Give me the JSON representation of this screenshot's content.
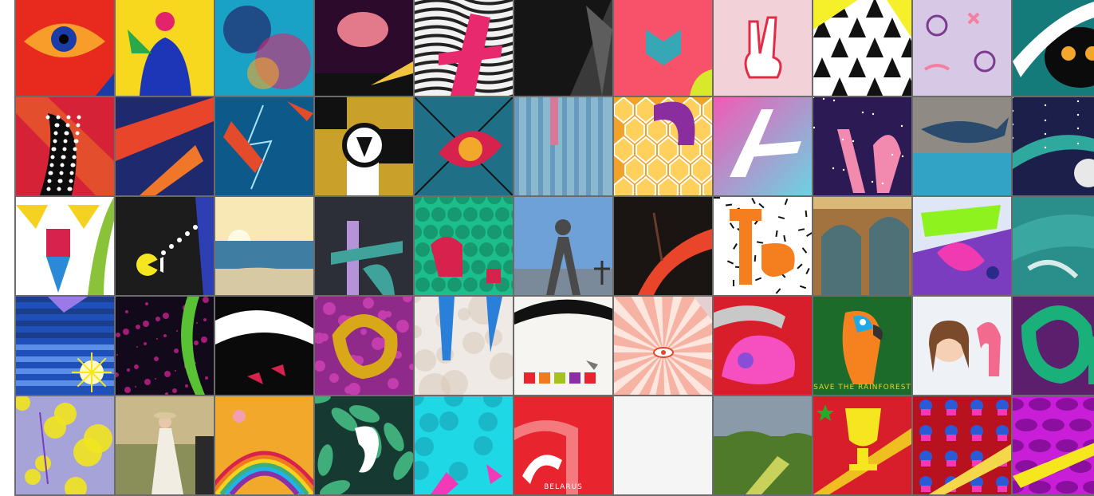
{
  "gallery": {
    "columns": 11,
    "tiles": [
      {
        "id": "r1c1",
        "bg": "#e82a1e",
        "fg": "#ffcf2e",
        "accent": "#1b3ca6",
        "motif": "eye",
        "caption": ""
      },
      {
        "id": "r1c2",
        "bg": "#f7d81f",
        "fg": "#1d36b8",
        "accent": "#e3246c",
        "motif": "figure",
        "caption": ""
      },
      {
        "id": "r1c3",
        "bg": "#1aa2c6",
        "fg": "#d8266f",
        "accent": "#23135e",
        "motif": "ink",
        "caption": ""
      },
      {
        "id": "r1c4",
        "bg": "#2b0a2c",
        "fg": "#e37a8c",
        "accent": "#f2c33c",
        "motif": "brain",
        "caption": ""
      },
      {
        "id": "r1c5",
        "bg": "#f2f2f2",
        "fg": "#e8296d",
        "accent": "#222222",
        "motif": "waves",
        "caption": ""
      },
      {
        "id": "r1c6",
        "bg": "#3a3a3a",
        "fg": "#151515",
        "accent": "#5d5d5d",
        "motif": "dark",
        "caption": ""
      },
      {
        "id": "r1c7",
        "bg": "#f7526a",
        "fg": "#35a7b5",
        "accent": "#ff8a5c",
        "motif": "chevron",
        "caption": ""
      },
      {
        "id": "r1c8",
        "bg": "#f2d1d8",
        "fg": "#e32b46",
        "accent": "#ffffff",
        "motif": "hand",
        "caption": ""
      },
      {
        "id": "r1c9",
        "bg": "#ffffff",
        "fg": "#111111",
        "accent": "#f5f02a",
        "motif": "triangles",
        "caption": ""
      },
      {
        "id": "r1c10",
        "bg": "#d7c9e6",
        "fg": "#7c3b8f",
        "accent": "#f57f9f",
        "motif": "pattern",
        "caption": ""
      },
      {
        "id": "r1c11",
        "bg": "#157b7a",
        "fg": "#0b0b0b",
        "accent": "#f2a72a",
        "motif": "cat",
        "caption": ""
      },
      {
        "id": "r2c1",
        "bg": "#d62236",
        "fg": "#0c0c0c",
        "accent": "#ffffff",
        "motif": "dots",
        "caption": ""
      },
      {
        "id": "r2c2",
        "bg": "#1f2a6e",
        "fg": "#e8452a",
        "accent": "#f0762a",
        "motif": "diagonal",
        "caption": ""
      },
      {
        "id": "r2c3",
        "bg": "#0d5a8a",
        "fg": "#e44b2a",
        "accent": "#a7e4ff",
        "motif": "lightning",
        "caption": ""
      },
      {
        "id": "r2c4",
        "bg": "#c9a12a",
        "fg": "#111111",
        "accent": "#ffffff",
        "motif": "geometric",
        "caption": ""
      },
      {
        "id": "r2c5",
        "bg": "#1f6f86",
        "fg": "#d8224e",
        "accent": "#111111",
        "motif": "curves",
        "caption": ""
      },
      {
        "id": "r2c6",
        "bg": "#8ab8cf",
        "fg": "#2f6da8",
        "accent": "#d67a9b",
        "motif": "glitch",
        "caption": ""
      },
      {
        "id": "r2c7",
        "bg": "#f0a22a",
        "fg": "#8a2d9e",
        "accent": "#ffd15c",
        "motif": "honeycomb",
        "caption": ""
      },
      {
        "id": "r2c8",
        "bg": "#6ad3e2",
        "fg": "#ffffff",
        "accent": "#f25ab6",
        "motif": "gradient",
        "caption": ""
      },
      {
        "id": "r2c9",
        "bg": "#2c1a55",
        "fg": "#f28ab0",
        "accent": "#9b7be0",
        "motif": "space",
        "caption": ""
      },
      {
        "id": "r2c10",
        "bg": "#8f8a83",
        "fg": "#2a4b6e",
        "accent": "#1aa7d6",
        "motif": "whale",
        "caption": ""
      },
      {
        "id": "r2c11",
        "bg": "#1b1f4a",
        "fg": "#2fa89e",
        "accent": "#e8e8e8",
        "motif": "moon",
        "caption": ""
      },
      {
        "id": "r3c1",
        "bg": "#ffffff",
        "fg": "#f5d21f",
        "accent": "#2a8ad8",
        "motif": "toy",
        "caption": ""
      },
      {
        "id": "r3c2",
        "bg": "#1c1c1c",
        "fg": "#f5e61f",
        "accent": "#2e3fb4",
        "motif": "pacman",
        "caption": ""
      },
      {
        "id": "r3c3",
        "bg": "#d8c9a5",
        "fg": "#f7e8b6",
        "accent": "#3f7da3",
        "motif": "beach",
        "caption": ""
      },
      {
        "id": "r3c4",
        "bg": "#2d2f38",
        "fg": "#3fa39b",
        "accent": "#b493d9",
        "motif": "letter",
        "caption": ""
      },
      {
        "id": "r3c5",
        "bg": "#1cbf8c",
        "fg": "#d8224e",
        "accent": "#16996f",
        "motif": "scales",
        "caption": ""
      },
      {
        "id": "r3c6",
        "bg": "#6da1d8",
        "fg": "#4a4a4a",
        "accent": "#e8f0f8",
        "motif": "statue",
        "caption": ""
      },
      {
        "id": "r3c7",
        "bg": "#1a1412",
        "fg": "#e8452a",
        "accent": "#6b3a2a",
        "motif": "ribbon",
        "caption": ""
      },
      {
        "id": "r3c8",
        "bg": "#ffffff",
        "fg": "#f57e1f",
        "accent": "#111111",
        "motif": "confetti",
        "caption": ""
      },
      {
        "id": "r3c9",
        "bg": "#a2733f",
        "fg": "#3a6f86",
        "accent": "#d9b878",
        "motif": "arches",
        "caption": ""
      },
      {
        "id": "r3c10",
        "bg": "#7a3dbf",
        "fg": "#8ef21f",
        "accent": "#ef3ab1",
        "motif": "splash",
        "caption": ""
      },
      {
        "id": "r3c11",
        "bg": "#2a8e8a",
        "fg": "#3aa7a1",
        "accent": "#d7ece8",
        "motif": "teal",
        "caption": ""
      },
      {
        "id": "r4c1",
        "bg": "#1f4fb8",
        "fg": "#ffffff",
        "accent": "#f5e61f",
        "motif": "stripes",
        "caption": ""
      },
      {
        "id": "r4c2",
        "bg": "#120a1a",
        "fg": "#c8228e",
        "accent": "#59c234",
        "motif": "galaxy",
        "caption": ""
      },
      {
        "id": "r4c3",
        "bg": "#0a0a0a",
        "fg": "#ffffff",
        "accent": "#d8224e",
        "motif": "stroke",
        "caption": ""
      },
      {
        "id": "r4c4",
        "bg": "#8f2a8a",
        "fg": "#d9a818",
        "accent": "#c43dae",
        "motif": "bubbles",
        "caption": ""
      },
      {
        "id": "r4c5",
        "bg": "#efeae6",
        "fg": "#2a7fd8",
        "accent": "#d8c6b6",
        "motif": "circles",
        "caption": ""
      },
      {
        "id": "r4c6",
        "bg": "#f7f5f2",
        "fg": "#111111",
        "accent": "#d8224e",
        "motif": "squares",
        "caption": ""
      },
      {
        "id": "r4c7",
        "bg": "#f6b3a3",
        "fg": "#e8452a",
        "accent": "#fde6de",
        "motif": "rays",
        "caption": ""
      },
      {
        "id": "r4c8",
        "bg": "#d81e2a",
        "fg": "#f54fc0",
        "accent": "#8a4dd8",
        "motif": "bird",
        "caption": ""
      },
      {
        "id": "r4c9",
        "bg": "#1c6b2a",
        "fg": "#f5821f",
        "accent": "#f2d21f",
        "motif": "parrot",
        "caption": "SAVE THE RAINFOREST"
      },
      {
        "id": "r4c10",
        "bg": "#eef2f7",
        "fg": "#f26a8e",
        "accent": "#7a4a2a",
        "motif": "girl",
        "caption": ""
      },
      {
        "id": "r4c11",
        "bg": "#5c1f6e",
        "fg": "#1ab07a",
        "accent": "#8f2fa5",
        "motif": "letter2",
        "caption": ""
      },
      {
        "id": "r5c1",
        "bg": "#a6a3d8",
        "fg": "#f2e61f",
        "accent": "#7a3dbf",
        "motif": "flowers",
        "caption": ""
      },
      {
        "id": "r5c2",
        "bg": "#8a8f5a",
        "fg": "#f2ede2",
        "accent": "#d9c89a",
        "motif": "bride",
        "caption": ""
      },
      {
        "id": "r5c3",
        "bg": "#f2a82a",
        "fg": "#d8224e",
        "accent": "#1fb4e8",
        "motif": "rainbow",
        "caption": ""
      },
      {
        "id": "r5c4",
        "bg": "#163a32",
        "fg": "#3fae7a",
        "accent": "#ffffff",
        "motif": "leaves",
        "caption": ""
      },
      {
        "id": "r5c5",
        "bg": "#1fd8e6",
        "fg": "#1ab7c9",
        "accent": "#f23ab8",
        "motif": "floral",
        "caption": ""
      },
      {
        "id": "r5c6",
        "bg": "#e8242e",
        "fg": "#ffffff",
        "accent": "#f57a7e",
        "motif": "belarus",
        "caption": "BELARUS"
      },
      {
        "id": "r5c7",
        "bg": "#fafafa",
        "fg": "#ffffff",
        "accent": "#eeeeee",
        "motif": "blank",
        "caption": ""
      },
      {
        "id": "r5c8",
        "bg": "#4f7a2a",
        "fg": "#c8d15a",
        "accent": "#a8a8a8",
        "motif": "hills",
        "caption": ""
      },
      {
        "id": "r5c9",
        "bg": "#d81e2a",
        "fg": "#f5e61f",
        "accent": "#2aa82a",
        "motif": "trophy",
        "caption": ""
      },
      {
        "id": "r5c10",
        "bg": "#b8121e",
        "fg": "#2a5ad8",
        "accent": "#f5d84a",
        "motif": "cupcakes",
        "caption": ""
      },
      {
        "id": "r5c11",
        "bg": "#c81ed8",
        "fg": "#8a0f9e",
        "accent": "#f5e61f",
        "motif": "spots",
        "caption": ""
      }
    ]
  }
}
